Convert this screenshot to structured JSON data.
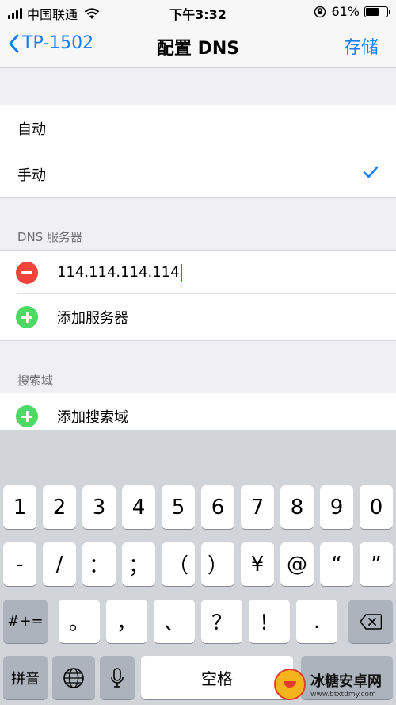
{
  "status_bar": {
    "carrier": "中国联通",
    "time": "下午3:32",
    "battery_percent": "61%",
    "battery_level": 0.61
  },
  "nav": {
    "back_label": "TP-1502",
    "title": "配置 DNS",
    "save_label": "存储",
    "accent_color": "#157efb"
  },
  "mode_group": {
    "items": [
      {
        "label": "自动",
        "selected": false
      },
      {
        "label": "手动",
        "selected": true
      }
    ]
  },
  "dns_section": {
    "header": "DNS 服务器",
    "servers": [
      "114.114.114.114"
    ],
    "add_label": "添加服务器"
  },
  "search_section": {
    "header": "搜索域",
    "add_label": "添加搜索域"
  },
  "keyboard": {
    "row1": [
      "1",
      "2",
      "3",
      "4",
      "5",
      "6",
      "7",
      "8",
      "9",
      "0"
    ],
    "row2": [
      "-",
      "/",
      "：",
      "；",
      "（",
      "）",
      "¥",
      "@",
      "“",
      "”"
    ],
    "row3_left": "#+=",
    "row3": [
      "。",
      "，",
      "、",
      "？",
      "！",
      "."
    ],
    "row3_right_icon": "backspace-icon",
    "row4_left": "拼音",
    "row4_globe_icon": "globe-icon",
    "row4_mic_icon": "microphone-icon",
    "space_label": "空格"
  },
  "watermark": {
    "name": "冰糖安卓网",
    "url": "www.btxtdmy.com"
  }
}
